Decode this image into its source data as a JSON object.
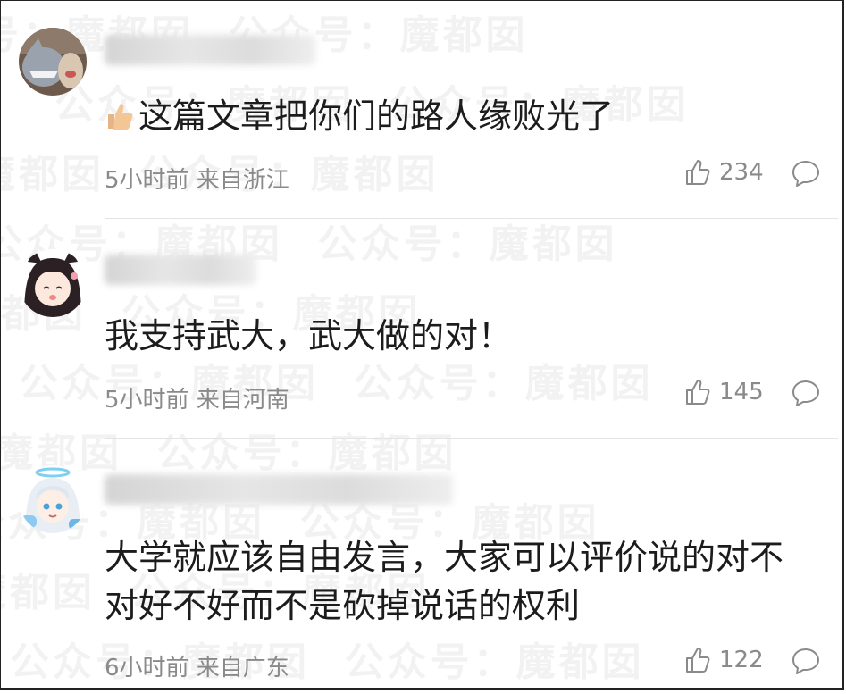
{
  "watermark": {
    "text": "公众号：魔都囡"
  },
  "comments": [
    {
      "emoji": "thumbs-up-emoji",
      "text": "这篇文章把你们的路人缘败光了",
      "meta": "5小时前 来自浙江",
      "likes": "234"
    },
    {
      "text": "我支持武大，武大做的对！",
      "meta": "5小时前 来自河南",
      "likes": "145"
    },
    {
      "text_line1": "大学就应该自由发言，大家可以评价说的对不",
      "text_line2": "对好不好而不是砍掉说话的权利",
      "meta": "6小时前 来自广东",
      "likes": "122"
    }
  ],
  "icons": {
    "like": "thumbs-up-outline-icon",
    "reply": "speech-bubble-icon"
  },
  "colors": {
    "text": "#1c1c1c",
    "meta": "#8a8a8a",
    "divider": "#e4e4e4"
  }
}
